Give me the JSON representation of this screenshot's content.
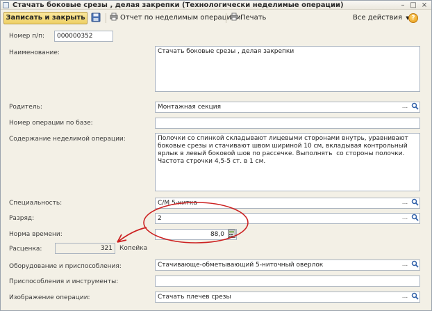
{
  "window": {
    "title": "Стачать боковые срезы , делая закрепки (Технологически неделимые операции)",
    "controls": {
      "minimize": "–",
      "maximize": "□",
      "close": "×"
    }
  },
  "toolbar": {
    "save_close_label": "Записать и закрыть",
    "report_label": "Отчет по неделимым операциям",
    "print_label": "Печать",
    "all_actions_label": "Все действия",
    "help_label": "?"
  },
  "form": {
    "number": {
      "label": "Номер п/п:",
      "value": "000000352"
    },
    "name": {
      "label": "Наименование:",
      "value": "Стачать боковые срезы , делая закрепки"
    },
    "parent": {
      "label": "Родитель:",
      "value": "Монтажная секция"
    },
    "base_op_number": {
      "label": "Номер операции по базе:",
      "value": ""
    },
    "content": {
      "label": "Содержание неделимой операции:",
      "value": "Полочки со спинкой складывают лицевыми сторонами внутрь, уравнивают боковые срезы и стачивают швом шириной 10 см, вкладывая контрольный ярлык в левый боковой шов по рассечке. Выполнять  со стороны полочки. Частота строчки 4,5-5 ст. в 1 см."
    },
    "specialty": {
      "label": "Специальность:",
      "value": "С/М 5-нитка"
    },
    "grade": {
      "label": "Разряд:",
      "value": "2"
    },
    "time_norm": {
      "label": "Норма времени:",
      "value": "88,0"
    },
    "rate": {
      "label": "Расценка:",
      "value": "321",
      "suffix": "Копейка"
    },
    "equipment": {
      "label": "Оборудование и приспособления:",
      "value": "Стачивающе-обметывающий 5-ниточный оверлок"
    },
    "tools": {
      "label": "Приспособления и инструменты:",
      "value": ""
    },
    "image": {
      "label": "Изображение операции:",
      "value": "Стачать плечев срезы"
    }
  },
  "icons": {
    "picker": "...",
    "search": "magnifier-icon",
    "calculator": "calculator-icon"
  },
  "colors": {
    "window_bg": "#f3f0e6",
    "primary_button": "#f3da78",
    "annotation": "#cc2222"
  }
}
